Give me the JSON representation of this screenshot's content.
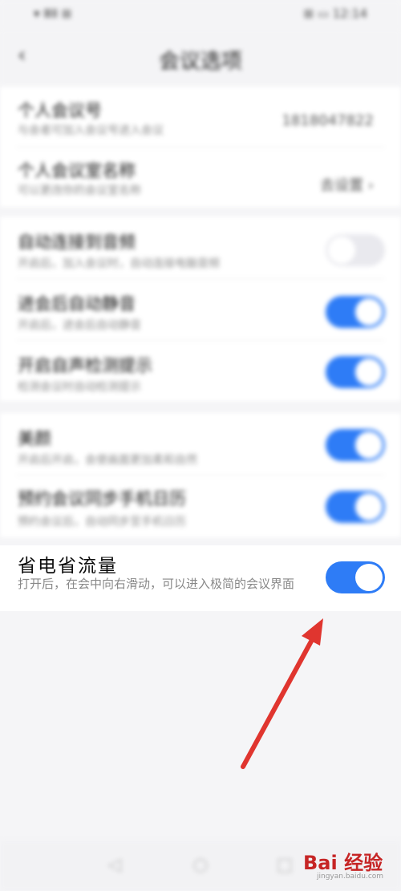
{
  "status_bar": {
    "left": "▾ ⅢⅡ ⊞",
    "right": "⊞ ▭ 12:14"
  },
  "nav": {
    "title": "会议选项",
    "back_icon": "chevron-left-icon"
  },
  "section1": [
    {
      "title": "个人会议号",
      "subtitle": "与会者可加入会议号进入会议",
      "value": "1818047822"
    },
    {
      "title": "个人会议室名称",
      "subtitle": "可以更改你的会议室名称",
      "value": "去设置 ›"
    }
  ],
  "section2": [
    {
      "title": "自动连接到音频",
      "subtitle": "开启后，加入会议时，自动连接电脑音频",
      "on": false
    },
    {
      "title": "进会后自动静音",
      "subtitle": "开启后，进会后自动静音",
      "on": true
    },
    {
      "title": "开启自声检测提示",
      "subtitle": "检测会议时自动检测提示",
      "on": true
    }
  ],
  "section3": [
    {
      "title": "美颜",
      "subtitle": "开启后开启，会使画面更加柔和自然",
      "on": true
    },
    {
      "title": "预约会议同步手机日历",
      "subtitle": "预约会议后，自动同步至手机日历",
      "on": true
    }
  ],
  "focus_row": {
    "title": "省电省流量",
    "subtitle": "打开后，在会中向右滑动，可以进入极简的会议界面",
    "on": true
  },
  "annotation": {
    "color": "#e0352f"
  },
  "watermark": {
    "main": "Bai 经验",
    "sub": "jingyan.baidu.com"
  },
  "colors": {
    "accent": "#2e7cf6",
    "background": "#f5f5f7"
  }
}
